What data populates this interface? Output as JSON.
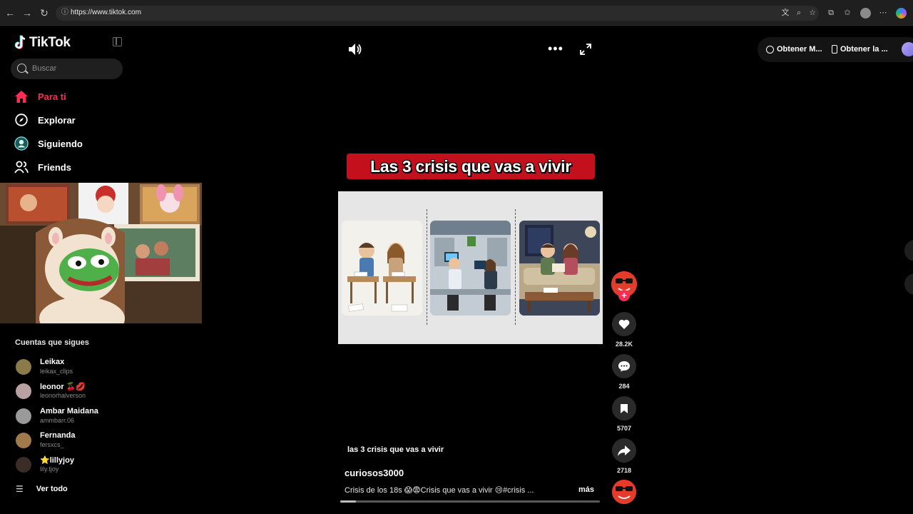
{
  "browser": {
    "url": "https://www.tiktok.com"
  },
  "sidebar": {
    "logo_text": "TikTok",
    "search_placeholder": "Buscar",
    "nav": [
      {
        "label": "Para ti",
        "icon": "home-icon",
        "active": true
      },
      {
        "label": "Explorar",
        "icon": "compass-icon"
      },
      {
        "label": "Siguiendo",
        "icon": "following-icon"
      },
      {
        "label": "Friends",
        "icon": "friends-icon"
      }
    ],
    "following_title": "Cuentas que sigues",
    "following": [
      {
        "name": "Leikax",
        "handle": "leikax_clips"
      },
      {
        "name": "leonor 🍒💋",
        "handle": "leonorhalverson"
      },
      {
        "name": "Ambar Maidana",
        "handle": "ammbarr.06"
      },
      {
        "name": "Fernanda",
        "handle": "fersxcs_"
      },
      {
        "name": "⭐lillyjoy",
        "handle": "lily.tjoy"
      }
    ],
    "see_all": "Ver todo"
  },
  "video": {
    "overlay_title": "Las 3 crisis que vas a vivir",
    "caption": "las 3 crisis que vas a vivir",
    "author": "curiosos3000",
    "description": "Crisis de los 18s 😱😨Crisis que vas a vivir 😢#crisis ...",
    "more": "más",
    "progress": 0.06
  },
  "actions": {
    "likes": "28.2K",
    "comments": "284",
    "saves": "5707",
    "shares": "2718",
    "follow_symbol": "+"
  },
  "top_right": {
    "item1": "Obtener M...",
    "item2": "Obtener la ..."
  },
  "colors": {
    "accent": "#fe2c55",
    "banner": "#c4101c"
  }
}
